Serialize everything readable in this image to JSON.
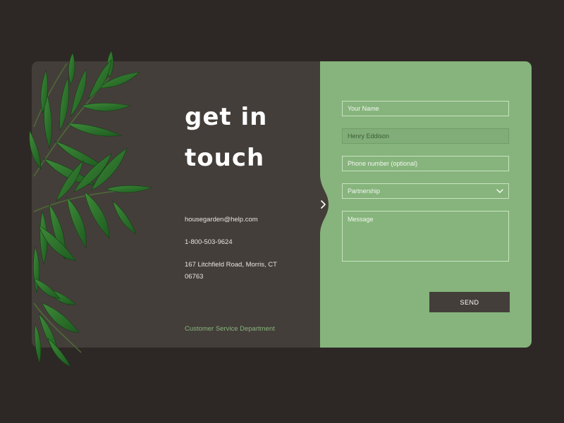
{
  "colors": {
    "background": "#2d2825",
    "left_panel": "#443e3a",
    "right_panel": "#86b47c",
    "accent_green": "#86b47c",
    "button": "#443e3a"
  },
  "heading": {
    "line1": "get in",
    "line2": "touch"
  },
  "contact": {
    "email": "housegarden@help.com",
    "phone": "1-800-503-9624",
    "address": "167 Litchfield Road, Morris, CT 06763",
    "department": "Customer Service Department"
  },
  "form": {
    "name_placeholder": "Your Name",
    "company_value": "Henry Eddison",
    "phone_placeholder": "Phone number (optional)",
    "topic_selected": "Partnership",
    "message_placeholder": "Message",
    "send_label": "SEND"
  },
  "icons": {
    "arrow": "chevron-right-icon",
    "select": "chevron-down-icon",
    "decoration": "leaves-icon"
  }
}
